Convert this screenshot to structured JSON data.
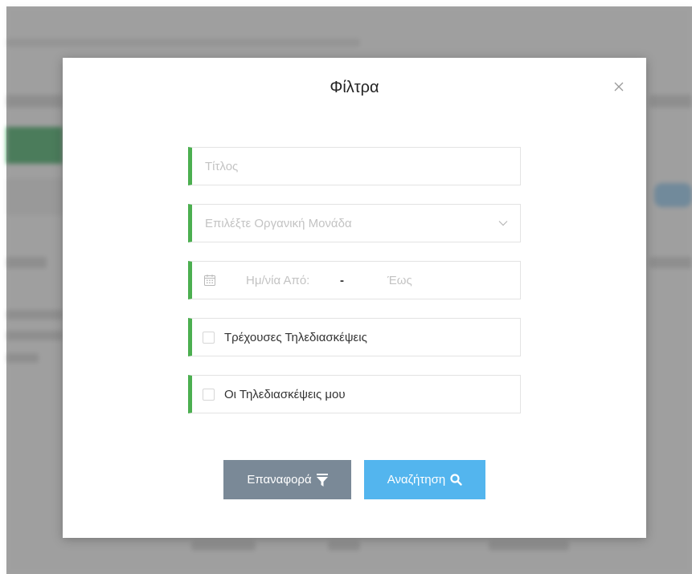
{
  "modal": {
    "title": "Φίλτρα",
    "fields": {
      "title_placeholder": "Τίτλος",
      "org_unit_placeholder": "Επιλέξτε Οργανική Μονάδα",
      "date_from_placeholder": "Ημ/νία Από:",
      "date_separator": "-",
      "date_to_placeholder": "Έως",
      "current_conferences_label": "Τρέχουσες Τηλεδιασκέψεις",
      "current_conferences_checked": false,
      "my_conferences_label": "Οι Τηλεδιασκέψεις μου",
      "my_conferences_checked": false
    },
    "buttons": {
      "reset_label": "Επαναφορά",
      "search_label": "Αναζήτηση"
    }
  },
  "colors": {
    "field_accent": "#4caf50",
    "reset_button": "#7a8997",
    "search_button": "#53b5ee"
  },
  "icons": [
    "close-icon",
    "chevron-down-icon",
    "calendar-icon",
    "filter-icon",
    "search-icon"
  ]
}
